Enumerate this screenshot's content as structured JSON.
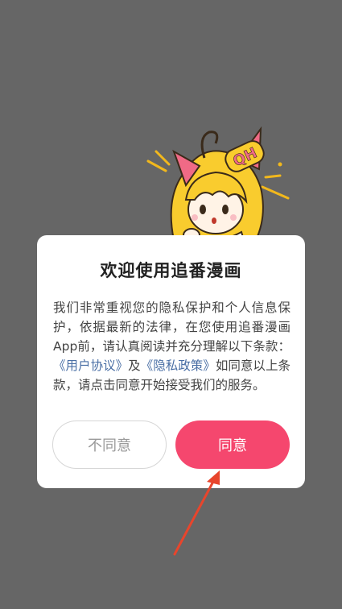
{
  "dialog": {
    "title": "欢迎使用追番漫画",
    "body_prefix": "我们非常重视您的隐私保护和个人信息保护，依据最新的法律，在您使用追番漫画App前，请认真阅读并充分理解以下条款：",
    "user_agreement_link": "《用户协议》",
    "and_text": "及",
    "privacy_policy_link": "《隐私政策》",
    "body_suffix": "如同意以上条款，请点击同意开始接受我们的服务。",
    "disagree_label": "不同意",
    "agree_label": "同意"
  },
  "mascot": {
    "hairpin_text": "QH"
  },
  "colors": {
    "overlay": "#666666",
    "accent": "#f5476e",
    "link": "#4a6fa5",
    "arrow": "#e8452c"
  }
}
